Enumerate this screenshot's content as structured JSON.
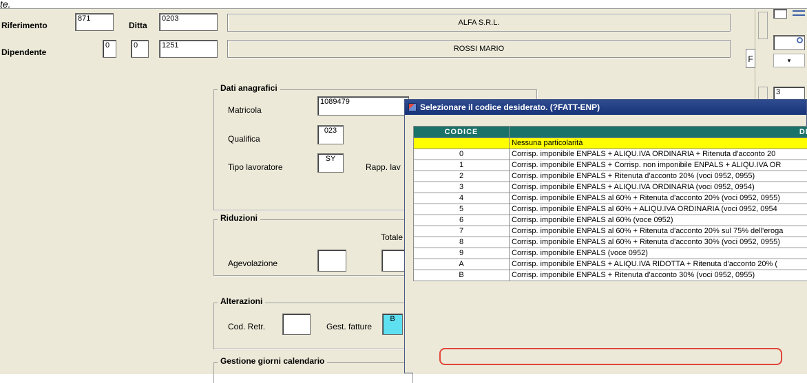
{
  "top_cut_text": "te.",
  "header": {
    "riferimento_label": "Riferimento",
    "riferimento_value": "871",
    "ditta_label": "Ditta",
    "ditta_value": "0203",
    "ditta_name": "ALFA S.R.L.",
    "dipendente_label": "Dipendente",
    "dip_value1": "0",
    "dip_value2": "0",
    "dip_value3": "1251",
    "dipendente_name": "ROSSI MARIO"
  },
  "dati_anagrafici": {
    "title": "Dati anagrafici",
    "matricola_label": "Matricola",
    "matricola_value": "1089479",
    "qualifica_label": "Qualifica",
    "qualifica_value": "023",
    "tipo_label": "Tipo lavoratore",
    "tipo_value": "SY",
    "rapp_label": "Rapp. lav"
  },
  "riduzioni": {
    "title": "Riduzioni",
    "totale_label": "Totale",
    "agevolazione_label": "Agevolazione"
  },
  "alterazioni": {
    "title": "Alterazioni",
    "cod_retr_label": "Cod. Retr.",
    "gest_fatture_label": "Gest. fatture",
    "gest_fatture_value": "B"
  },
  "gestione": {
    "title": "Gestione giorni calendario"
  },
  "right_panel": {
    "f_label": "F",
    "num": "3"
  },
  "dialog": {
    "title": "Selezionare il codice desiderato.   (?FATT-ENP)",
    "col_codice": "CODICE",
    "col_descrizione": "DESCRIZIONE",
    "rows": [
      {
        "code": "",
        "desc": "Nessuna particolarità",
        "selected": true
      },
      {
        "code": "0",
        "desc": "Corrisp. imponibile ENPALS + ALIQU.IVA ORDINARIA + Ritenuta d'acconto 20"
      },
      {
        "code": "1",
        "desc": "Corrisp. imponibile ENPALS + Corrisp. non imponibile ENPALS + ALIQU.IVA OR"
      },
      {
        "code": "2",
        "desc": "Corrisp. imponibile ENPALS + Ritenuta d'acconto 20% (voci 0952, 0955)"
      },
      {
        "code": "3",
        "desc": "Corrisp. imponibile ENPALS + ALIQU.IVA ORDINARIA (voci 0952, 0954)"
      },
      {
        "code": "4",
        "desc": "Corrisp. imponibile ENPALS al 60% + Ritenuta d'acconto 20% (voci 0952, 0955)"
      },
      {
        "code": "5",
        "desc": "Corrisp. imponibile ENPALS al 60% + ALIQU.IVA ORDINARIA (voci 0952, 0954"
      },
      {
        "code": "6",
        "desc": "Corrisp. imponibile ENPALS al 60% (voce 0952)"
      },
      {
        "code": "7",
        "desc": "Corrisp. imponibile ENPALS al 60% + Ritenuta d'acconto 20% sul 75% dell'eroga"
      },
      {
        "code": "8",
        "desc": "Corrisp. imponibile ENPALS al 60% + Ritenuta d'acconto 30% (voci 0952, 0955)"
      },
      {
        "code": "9",
        "desc": "Corrisp. imponibile ENPALS (voce 0952)"
      },
      {
        "code": "A",
        "desc": "Corrisp. imponibile ENPALS + ALIQU.IVA RIDOTTA + Ritenuta d'acconto 20% ("
      },
      {
        "code": "B",
        "desc": "Corrisp. imponibile ENPALS + Ritenuta d'acconto 30% (voci 0952, 0955)"
      }
    ]
  },
  "colors": {
    "header_teal": "#1a7269",
    "selected_row": "#ffff00",
    "gest_fatture_bg": "#5ee0f0",
    "highlight": "#e0463a"
  }
}
